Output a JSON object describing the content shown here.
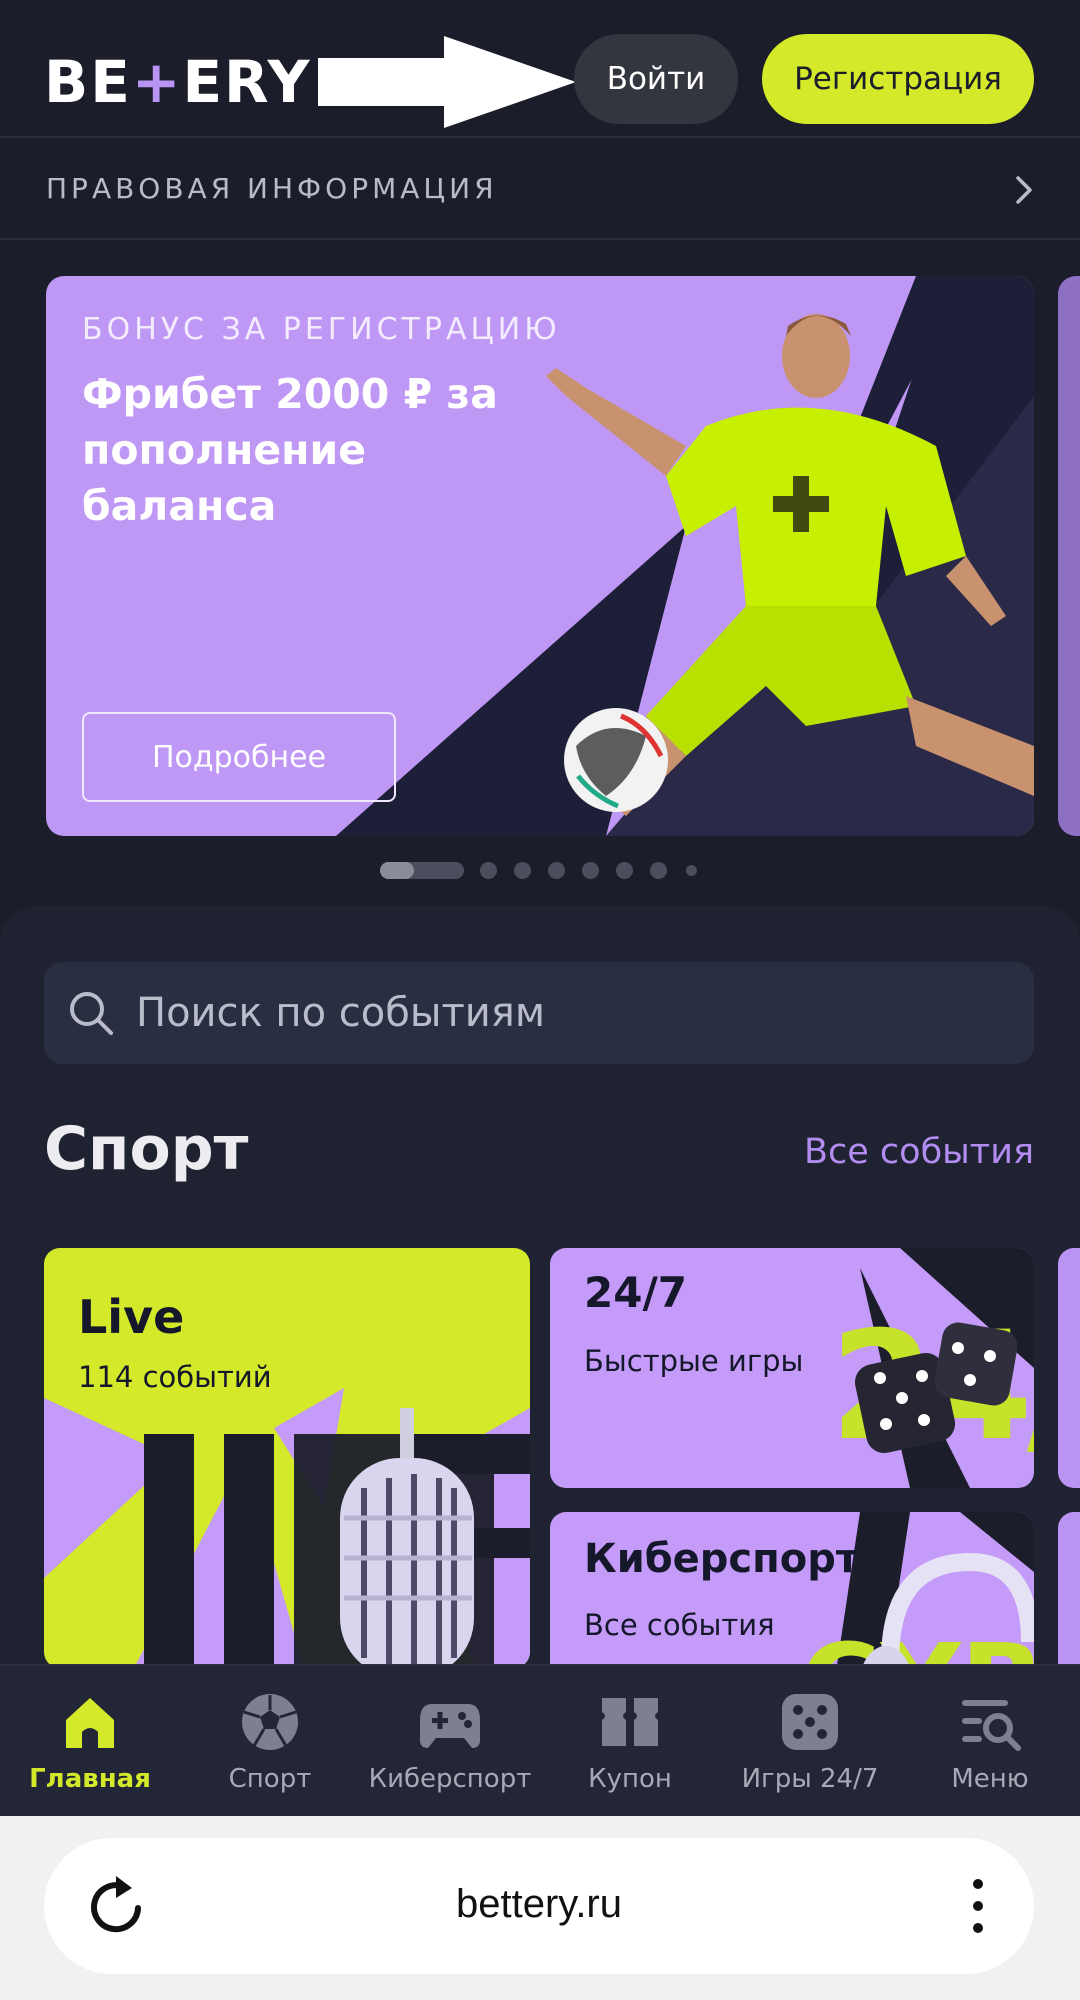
{
  "header": {
    "logo_left": "BE",
    "logo_plus": "+",
    "logo_right": "ERY",
    "login_label": "Войти",
    "register_label": "Регистрация"
  },
  "legal": {
    "label": "ПРАВОВАЯ ИНФОРМАЦИЯ"
  },
  "banner": {
    "kicker": "БОНУС ЗА РЕГИСТРАЦИЮ",
    "title": "Фрибет 2000 ₽ за пополнение баланса",
    "cta_label": "Подробнее",
    "slide_count": 8,
    "active_slide": 1
  },
  "search": {
    "placeholder": "Поиск по событиям"
  },
  "sport": {
    "title": "Спорт",
    "all_label": "Все события",
    "tiles": [
      {
        "title": "Live",
        "subtitle": "114 событий"
      },
      {
        "title": "24/7",
        "subtitle": "Быстрые игры"
      },
      {
        "title": "Киберспорт",
        "subtitle": "Все события"
      }
    ]
  },
  "nav": {
    "items": [
      {
        "label": "Главная",
        "icon": "home-icon",
        "active": true
      },
      {
        "label": "Спорт",
        "icon": "soccer-ball-icon"
      },
      {
        "label": "Киберспорт",
        "icon": "gamepad-icon"
      },
      {
        "label": "Купон",
        "icon": "coupon-icon"
      },
      {
        "label": "Игры 24/7",
        "icon": "dice-icon"
      },
      {
        "label": "Меню",
        "icon": "menu-search-icon"
      }
    ]
  },
  "browser": {
    "url": "bettery.ru"
  },
  "colors": {
    "background": "#1b1d2a",
    "accent_lime": "#d3e92a",
    "accent_purple": "#bf97f5",
    "link_purple": "#b38cf2"
  }
}
